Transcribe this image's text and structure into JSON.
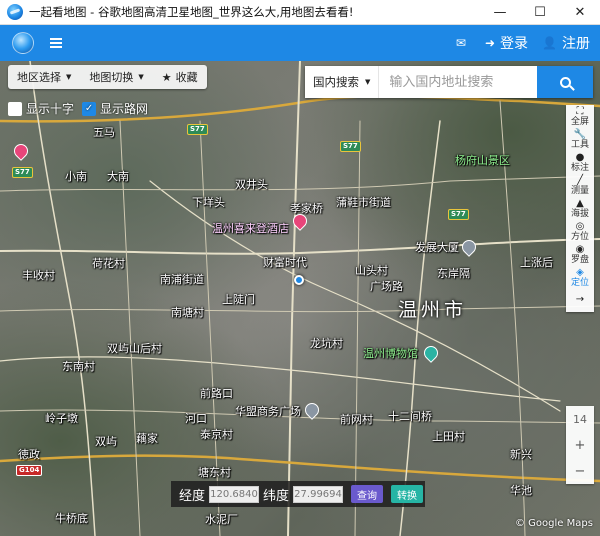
{
  "window": {
    "title": "一起看地图 - 谷歌地图高清卫星地图_世界这么大,用地图去看看!",
    "minimize": "—",
    "maximize": "☐",
    "close": "✕"
  },
  "header": {
    "login": "登录",
    "register": "注册"
  },
  "toolbar": {
    "region": "地区选择",
    "map_switch": "地图切换",
    "favorite": "收藏"
  },
  "checks": {
    "crosshair": "显示十字",
    "roadnet": "显示路网"
  },
  "search": {
    "scope": "国内搜索",
    "placeholder": "输入国内地址搜索"
  },
  "right_tools": [
    {
      "label": "全屏",
      "icon": "⛶"
    },
    {
      "label": "工具",
      "icon": "🔧"
    },
    {
      "label": "标注",
      "icon": "●"
    },
    {
      "label": "测量",
      "icon": "╱"
    },
    {
      "label": "海拔",
      "icon": "▲"
    },
    {
      "label": "方位",
      "icon": "◎"
    },
    {
      "label": "罗盘",
      "icon": "◉"
    },
    {
      "label": "定位",
      "icon": "◈"
    }
  ],
  "zoom": {
    "level": "14",
    "plus": "+",
    "minus": "−"
  },
  "coords": {
    "lng_label": "经度",
    "lng_value": "120.6840",
    "lat_label": "纬度",
    "lat_value": "27.99694",
    "query": "查询",
    "convert": "转换"
  },
  "attribution": "© Google Maps",
  "map_labels": {
    "city": "温州市",
    "l1": "五马",
    "l2": "小南",
    "l3": "大南",
    "l4": "杨府山景区",
    "l5": "双井头",
    "l6": "孝家桥",
    "l7": "蒲鞋市街道",
    "l8": "下垟头",
    "l9": "温州喜来登酒店",
    "l10": "财富时代",
    "l11": "发展大厦",
    "l12": "荷花村",
    "l13": "丰收村",
    "l14": "南浦街道",
    "l15": "上陡门",
    "l16": "山头村",
    "l17": "东岸隔",
    "l18": "南塘村",
    "l19": "双屿山后村",
    "l20": "龙坑村",
    "l21": "温州博物馆",
    "l22": "东南村",
    "l23": "前路口",
    "l24": "华盟商务广场",
    "l25": "河口",
    "l26": "泰京村",
    "l27": "塘东村",
    "l28": "水泥厂",
    "l29": "上田村",
    "l30": "十二间桥",
    "l31": "前网村",
    "l32": "徳政",
    "l33": "岭子墩",
    "l34": "双屿",
    "l35": "藕家",
    "l36": "广场路",
    "l37": "牛桥底",
    "l38": "新兴",
    "l39": "华池",
    "l40": "上涨后"
  },
  "shields": {
    "s1": "S77",
    "s2": "S77",
    "s3": "S77",
    "s4": "S77",
    "s5": "G104"
  }
}
